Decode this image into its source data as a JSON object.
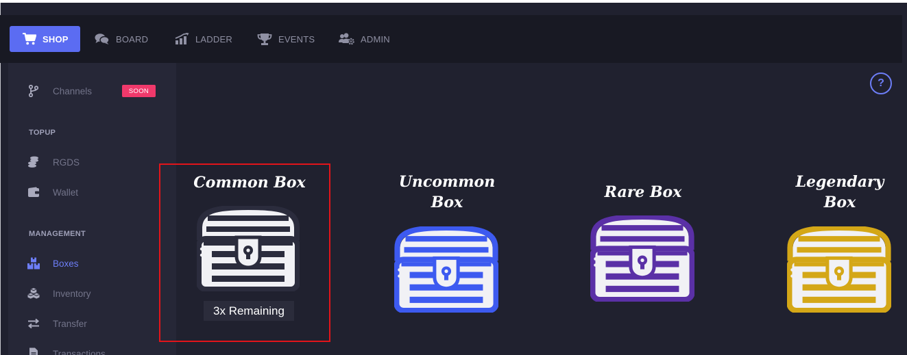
{
  "nav": {
    "items": [
      {
        "label": "SHOP",
        "icon": "cart-icon",
        "active": true
      },
      {
        "label": "BOARD",
        "icon": "chat-bubbles-icon"
      },
      {
        "label": "LADDER",
        "icon": "ladder-chart-icon"
      },
      {
        "label": "EVENTS",
        "icon": "trophy-icon"
      },
      {
        "label": "ADMIN",
        "icon": "users-gear-icon"
      }
    ]
  },
  "sidebar": {
    "channels": {
      "label": "Channels",
      "badge": "SOON",
      "icon": "branch-icon"
    },
    "topup": {
      "title": "TOPUP",
      "items": [
        {
          "label": "RGDS",
          "icon": "coins-icon"
        },
        {
          "label": "Wallet",
          "icon": "wallet-icon"
        }
      ]
    },
    "management": {
      "title": "MANAGEMENT",
      "items": [
        {
          "label": "Boxes",
          "icon": "boxes-icon",
          "active": true
        },
        {
          "label": "Inventory",
          "icon": "cubes-icon"
        },
        {
          "label": "Transfer",
          "icon": "transfer-arrows-icon"
        },
        {
          "label": "Transactions",
          "icon": "receipt-icon"
        }
      ]
    }
  },
  "help": {
    "label": "?"
  },
  "boxes": [
    {
      "title": "Common Box",
      "title_lines": [
        "Common Box"
      ],
      "color": "#2b2c3d",
      "remaining": "3x Remaining",
      "selected": true
    },
    {
      "title": "Uncommon Box",
      "title_lines": [
        "Uncommon",
        "Box"
      ],
      "color": "#3d5af0"
    },
    {
      "title": "Rare Box",
      "title_lines": [
        "Rare Box"
      ],
      "color": "#5a30a6"
    },
    {
      "title": "Legendary Box",
      "title_lines": [
        "Legendary",
        "Box"
      ],
      "color": "#d4a717"
    }
  ],
  "colors": {
    "accent": "#5b6cf2",
    "background": "#20212f",
    "sidebar": "#262737",
    "badge": "#f0396b",
    "selection": "#e3141a"
  }
}
